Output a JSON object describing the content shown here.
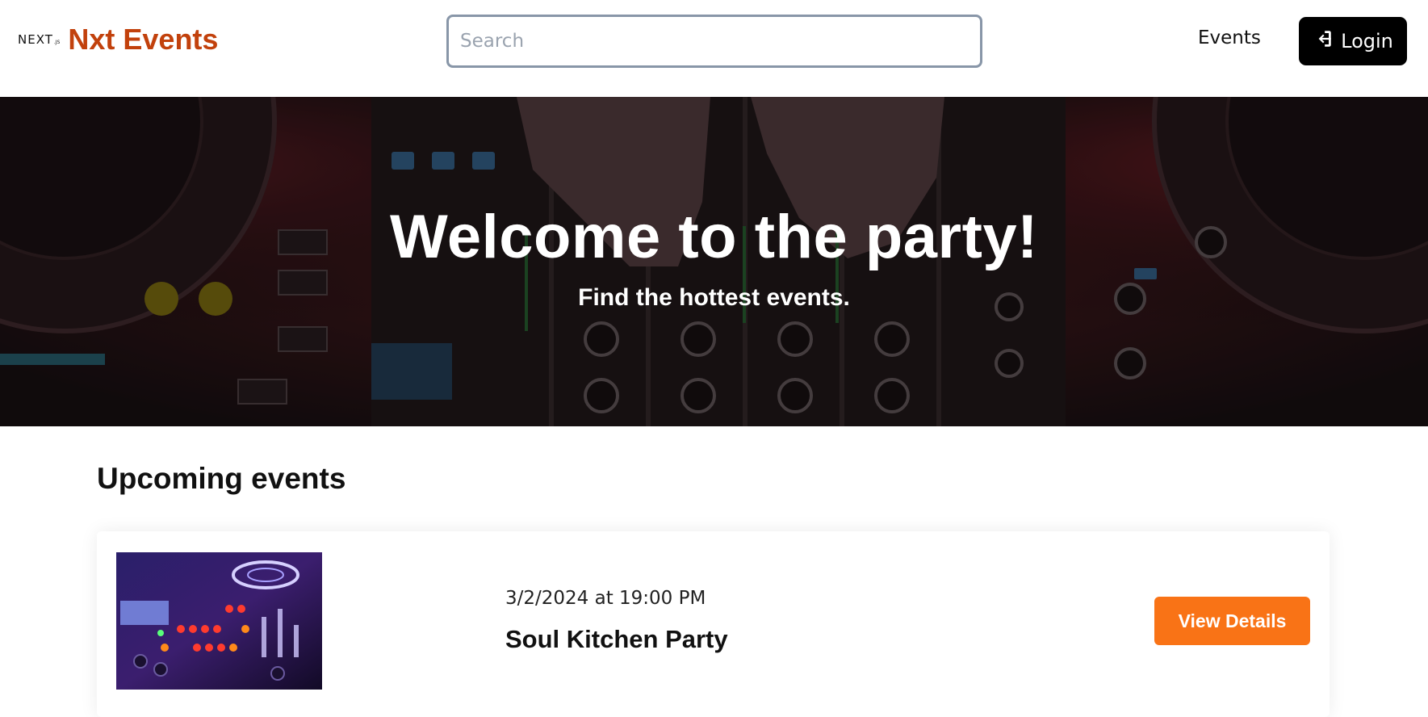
{
  "header": {
    "framework_logo_text": "NEXT",
    "framework_logo_suffix": ".JS",
    "brand_name": "Nxt Events",
    "search_placeholder": "Search",
    "nav_events": "Events",
    "login_label": "Login"
  },
  "hero": {
    "title": "Welcome to the party!",
    "subtitle": "Find the hottest events."
  },
  "upcoming": {
    "title": "Upcoming events",
    "events": [
      {
        "date": "3/2/2024 at 19:00 PM",
        "name": "Soul Kitchen Party",
        "button_label": "View Details"
      }
    ]
  },
  "colors": {
    "brand": "#c2410c",
    "accent_button": "#f97316",
    "login_button": "#000000"
  },
  "icons": {
    "login": "sign-in-icon"
  }
}
